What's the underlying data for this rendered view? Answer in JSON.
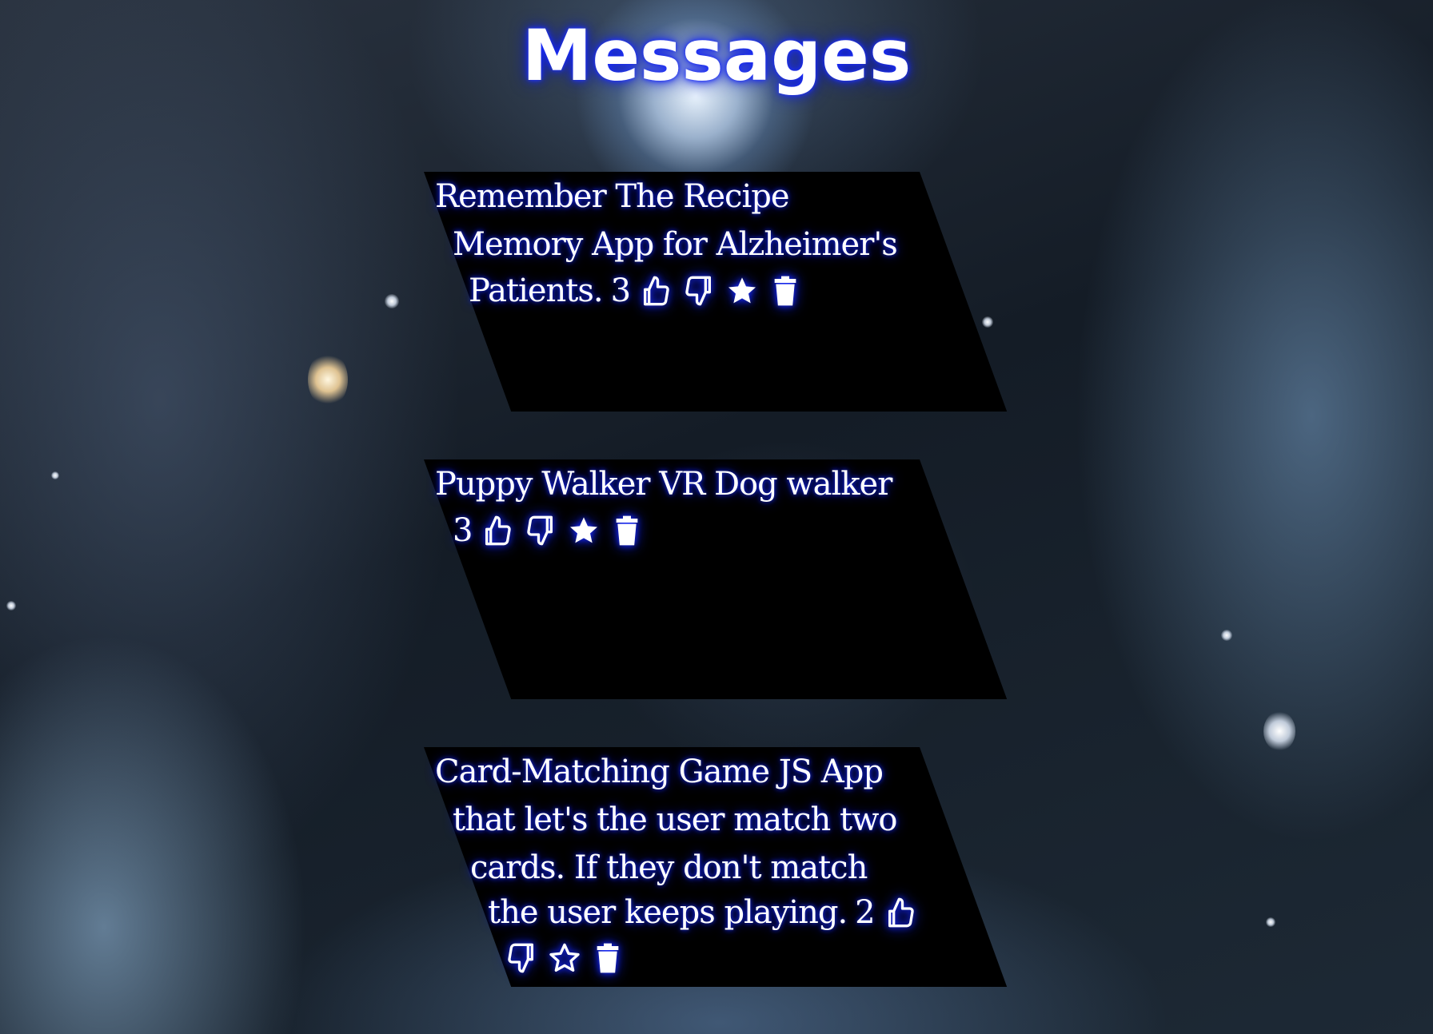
{
  "page": {
    "title": "Messages"
  },
  "messages": [
    {
      "lines": [
        "Remember The Recipe",
        "Memory App for Alzheimer's",
        "Patients."
      ],
      "count": "3",
      "starred": true
    },
    {
      "lines": [
        "Puppy Walker VR Dog walker"
      ],
      "count": "3",
      "starred": true
    },
    {
      "lines": [
        "Card-Matching Game JS App",
        "that let's the user match two",
        "cards. If they don't match",
        "the user keeps playing."
      ],
      "count": "2",
      "starred": false
    }
  ],
  "icons": {
    "like": "thumbs-up-icon",
    "dislike": "thumbs-down-icon",
    "star_filled": "star-icon",
    "star_outline": "star-outline-icon",
    "delete": "trash-icon"
  },
  "colors": {
    "card_bg": "#000000",
    "glow": "#1a2cff",
    "text": "#ffffff"
  }
}
